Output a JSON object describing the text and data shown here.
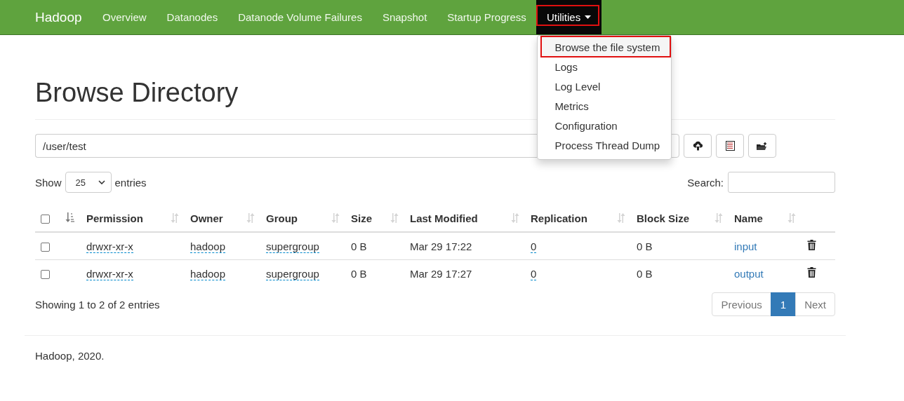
{
  "navbar": {
    "brand": "Hadoop",
    "items": [
      {
        "kind": "link",
        "label": "Overview",
        "selected": false,
        "highlighted": false
      },
      {
        "kind": "link",
        "label": "Datanodes",
        "selected": false,
        "highlighted": false
      },
      {
        "kind": "link",
        "label": "Datanode Volume Failures",
        "selected": false,
        "highlighted": false
      },
      {
        "kind": "link",
        "label": "Snapshot",
        "selected": false,
        "highlighted": false
      },
      {
        "kind": "link",
        "label": "Startup Progress",
        "selected": false,
        "highlighted": false
      },
      {
        "kind": "dropdown",
        "label": "Utilities",
        "selected": true,
        "highlighted": true
      }
    ]
  },
  "dropdown": {
    "items": [
      {
        "label": "Browse the file system",
        "highlighted": true
      },
      {
        "label": "Logs",
        "highlighted": false
      },
      {
        "label": "Log Level",
        "highlighted": false
      },
      {
        "label": "Metrics",
        "highlighted": false
      },
      {
        "label": "Configuration",
        "highlighted": false
      },
      {
        "label": "Process Thread Dump",
        "highlighted": false
      }
    ]
  },
  "page": {
    "title": "Browse Directory",
    "path": "/user/test",
    "toolbar": [
      {
        "kind": "covered"
      },
      {
        "kind": "upload"
      },
      {
        "kind": "list"
      },
      {
        "kind": "new-folder"
      }
    ]
  },
  "table": {
    "show_label": "Show",
    "page_size": "25",
    "entries_label": "entries",
    "search_label": "Search:",
    "columns": [
      {
        "kind": "checkbox",
        "checked": false
      },
      {
        "kind": "sort",
        "sorted": true
      },
      {
        "kind": "text",
        "label": "Permission",
        "sorted": false
      },
      {
        "kind": "text",
        "label": "Owner",
        "sorted": false
      },
      {
        "kind": "text",
        "label": "Group",
        "sorted": false
      },
      {
        "kind": "text",
        "label": "Size",
        "sorted": false
      },
      {
        "kind": "text",
        "label": "Last Modified",
        "sorted": false
      },
      {
        "kind": "text",
        "label": "Replication",
        "sorted": false
      },
      {
        "kind": "text",
        "label": "Block Size",
        "sorted": false
      },
      {
        "kind": "text",
        "label": "Name",
        "sorted": false
      },
      {
        "kind": "action"
      }
    ],
    "rows": [
      {
        "checked": false,
        "permission": "drwxr-xr-x",
        "owner": "hadoop",
        "group": "supergroup",
        "size": "0 B",
        "last_modified": "Mar 29 17:22",
        "replication": "0",
        "block_size": "0 B",
        "name": "input"
      },
      {
        "checked": false,
        "permission": "drwxr-xr-x",
        "owner": "hadoop",
        "group": "supergroup",
        "size": "0 B",
        "last_modified": "Mar 29 17:27",
        "replication": "0",
        "block_size": "0 B",
        "name": "output"
      }
    ],
    "info": "Showing 1 to 2 of 2 entries",
    "pagination": [
      {
        "label": "Previous",
        "selected": false
      },
      {
        "label": "1",
        "selected": true
      },
      {
        "label": "Next",
        "selected": false
      }
    ]
  },
  "footer": {
    "text": "Hadoop, 2020."
  }
}
